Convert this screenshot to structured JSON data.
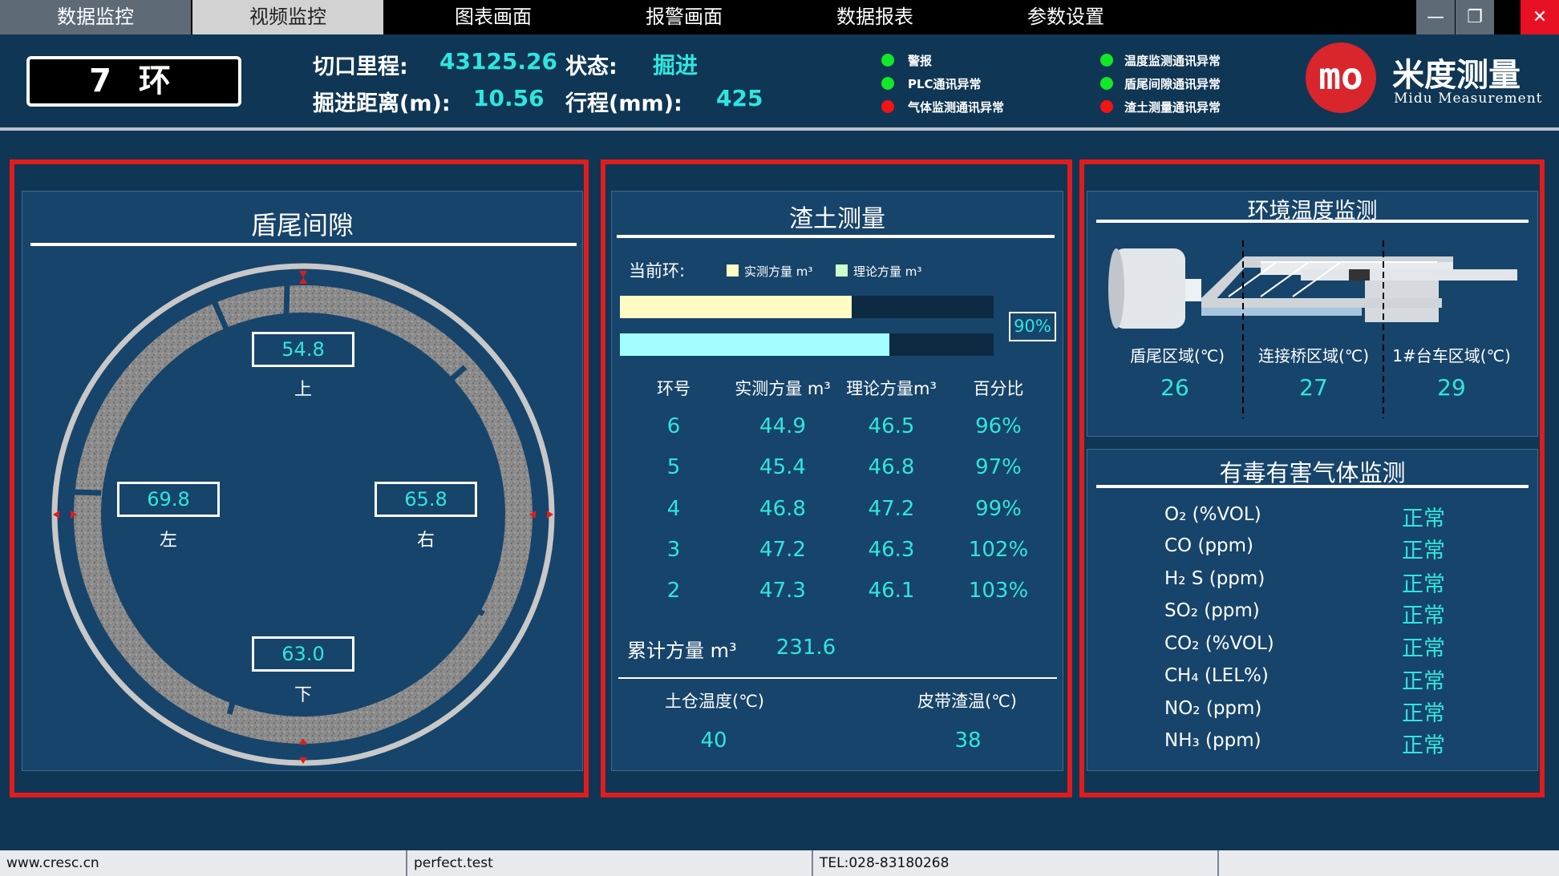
{
  "nav": {
    "tabs": [
      "数据监控",
      "视频监控",
      "图表画面",
      "报警画面",
      "数据报表",
      "参数设置"
    ],
    "minimize": "—",
    "maximize": "❐",
    "close": "✕"
  },
  "header": {
    "ring_number": "7 环",
    "mileage_label": "切口里程:",
    "mileage_value": "43125.26",
    "status_label": "状态:",
    "status_value": "掘进",
    "distance_label": "掘进距离(m):",
    "distance_value": "10.56",
    "stroke_label": "行程(mm):",
    "stroke_value": "425",
    "status_indicators": [
      {
        "label": "警报",
        "state": "green"
      },
      {
        "label": "PLC通讯异常",
        "state": "green"
      },
      {
        "label": "气体监测通讯异常",
        "state": "red"
      },
      {
        "label": "温度监测通讯异常",
        "state": "green"
      },
      {
        "label": "盾尾间隙通讯异常",
        "state": "green"
      },
      {
        "label": "渣土测量通讯异常",
        "state": "red"
      }
    ],
    "logo_mark": "mo",
    "logo_cn": "米度测量",
    "logo_en": "Midu Measurement"
  },
  "tail_gap": {
    "title": "盾尾间隙",
    "top": {
      "value": "54.8",
      "label": "上"
    },
    "left": {
      "value": "69.8",
      "label": "左"
    },
    "right": {
      "value": "65.8",
      "label": "右"
    },
    "bottom": {
      "value": "63.0",
      "label": "下"
    }
  },
  "muck": {
    "title": "渣土测量",
    "current_ring_label": "当前环:",
    "legend_measured": "实测方量 m³",
    "legend_theoretical": "理论方量 m³",
    "measured_fraction": 0.62,
    "theoretical_fraction": 0.72,
    "percent": "90%",
    "columns": [
      "环号",
      "实测方量 m³",
      "理论方量m³",
      "百分比"
    ],
    "rows": [
      [
        "6",
        "44.9",
        "46.5",
        "96%"
      ],
      [
        "5",
        "45.4",
        "46.8",
        "97%"
      ],
      [
        "4",
        "46.8",
        "47.2",
        "99%"
      ],
      [
        "3",
        "47.2",
        "46.3",
        "102%"
      ],
      [
        "2",
        "47.3",
        "46.1",
        "103%"
      ]
    ],
    "total_label": "累计方量 m³",
    "total_value": "231.6",
    "chamber_temp_label": "土仓温度(℃)",
    "chamber_temp_value": "40",
    "belt_temp_label": "皮带渣温(℃)",
    "belt_temp_value": "38"
  },
  "env_temp": {
    "title": "环境温度监测",
    "zones": [
      {
        "label": "盾尾区域(℃)",
        "value": "26"
      },
      {
        "label": "连接桥区域(℃)",
        "value": "27"
      },
      {
        "label": "1#台车区域(℃)",
        "value": "29"
      }
    ]
  },
  "gas": {
    "title": "有毒有害气体监测",
    "items": [
      {
        "name": "O₂ (%VOL)",
        "status": "正常"
      },
      {
        "name": "CO (ppm)",
        "status": "正常"
      },
      {
        "name": "H₂ S (ppm)",
        "status": "正常"
      },
      {
        "name": "SO₂ (ppm)",
        "status": "正常"
      },
      {
        "name": "CO₂ (%VOL)",
        "status": "正常"
      },
      {
        "name": "CH₄ (LEL%)",
        "status": "正常"
      },
      {
        "name": "NO₂ (ppm)",
        "status": "正常"
      },
      {
        "name": "NH₃ (ppm)",
        "status": "正常"
      }
    ]
  },
  "statusbar": {
    "website": "www.cresc.cn",
    "test": "perfect.test",
    "tel": "TEL:028-83180268"
  },
  "colors": {
    "accent": "#2ee6e0",
    "frame": "#e01c1c",
    "panel": "#17446a",
    "background": "#0f3654",
    "bar_measured": "#fffbc2",
    "bar_theoretical": "#a3ffff"
  }
}
